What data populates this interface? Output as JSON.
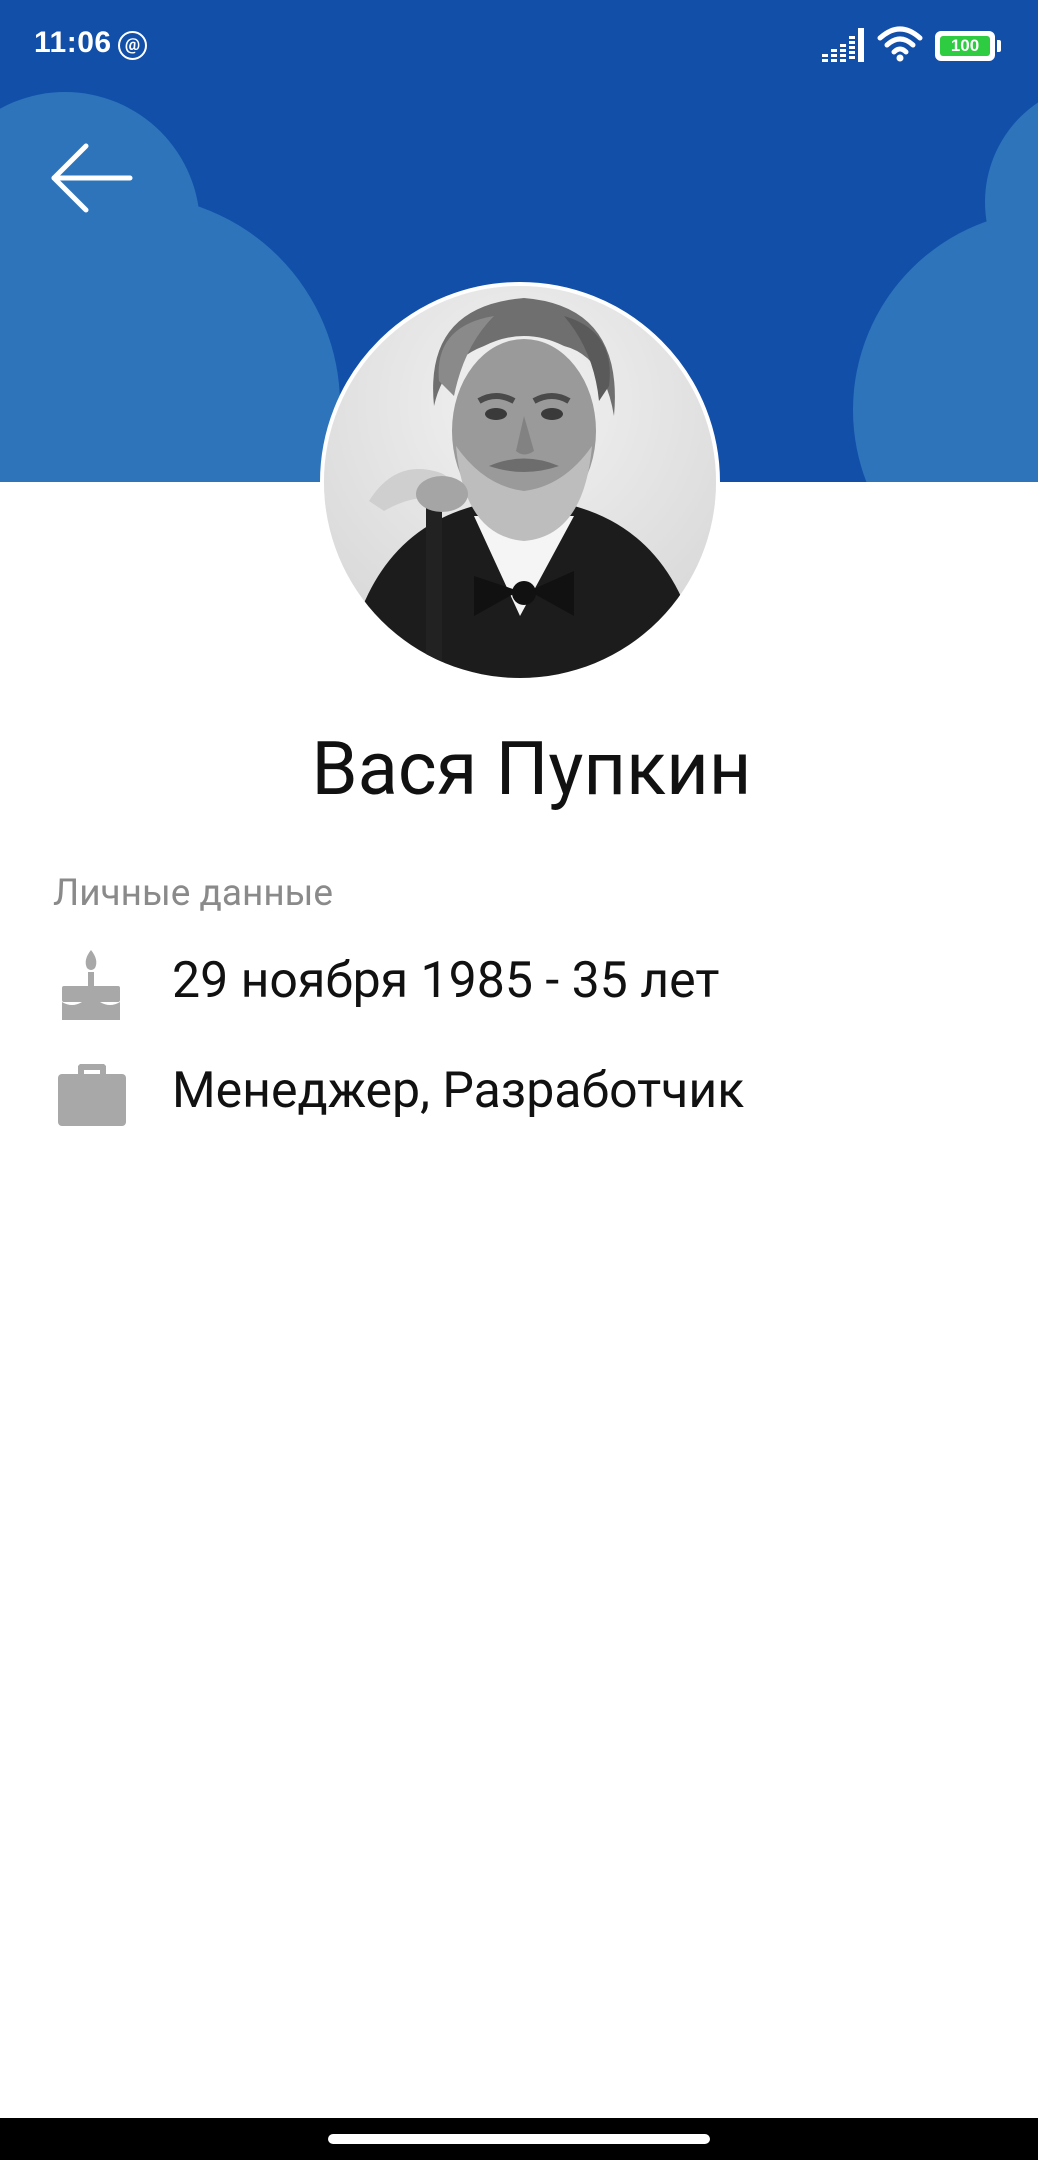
{
  "status_bar": {
    "time": "11:06",
    "at_badge": "@",
    "battery_level": "100",
    "icons": [
      "signal-icon",
      "wifi-icon",
      "battery-icon"
    ]
  },
  "header": {
    "background_color": "#124fa9",
    "cloud_color": "#2e74bb",
    "back_icon": "arrow-left-icon"
  },
  "profile": {
    "name": "Вася Пупкин",
    "avatar_icon": "profile-photo"
  },
  "personal_data": {
    "section_title": "Личные данные",
    "rows": [
      {
        "icon": "birthday-cake-icon",
        "text": "29 ноября 1985 - 35 лет"
      },
      {
        "icon": "briefcase-icon",
        "text": "Менеджер, Разработчик"
      }
    ]
  },
  "colors": {
    "icon_gray": "#a8a8a8",
    "text_primary": "#111111",
    "text_secondary": "#8a8a8a"
  }
}
